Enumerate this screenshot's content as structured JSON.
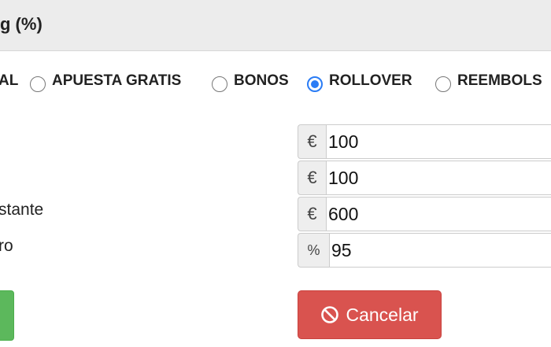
{
  "header": {
    "title": "g (%)"
  },
  "radio_options": [
    {
      "label": "AL",
      "checked": false
    },
    {
      "label": "APUESTA GRATIS",
      "checked": false
    },
    {
      "label": "BONOS",
      "checked": false
    },
    {
      "label": "ROLLOVER",
      "checked": true
    },
    {
      "label": "REEMBOLS",
      "checked": false
    }
  ],
  "fields": [
    {
      "label": "",
      "addon": "€",
      "value": "100"
    },
    {
      "label": "",
      "addon": "€",
      "value": "100"
    },
    {
      "label": "stante",
      "addon": "€",
      "value": "600"
    },
    {
      "label": "ro",
      "addon": "%",
      "value": "95"
    }
  ],
  "buttons": {
    "cancel_label": "Cancelar"
  },
  "colors": {
    "primary_radio": "#2a7cf5",
    "danger": "#d9534f",
    "success": "#5cb85c"
  },
  "icons": {
    "cancel": "ban-icon"
  }
}
